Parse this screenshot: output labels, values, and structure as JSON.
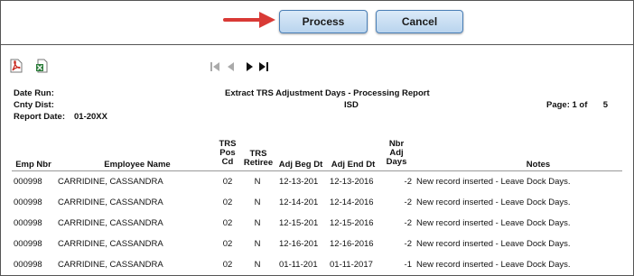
{
  "actions": {
    "process_label": "Process",
    "cancel_label": "Cancel"
  },
  "report": {
    "labels": {
      "date_run": "Date Run:",
      "cnty_dist": "Cnty Dist:",
      "report_date": "Report Date:"
    },
    "report_date_value": "01-20XX",
    "title": "Extract TRS Adjustment Days - Processing Report",
    "district": "ISD",
    "page_text": "Page: 1   of",
    "page_total": "5"
  },
  "table": {
    "headers": {
      "emp_nbr": "Emp Nbr",
      "employee_name": "Employee Name",
      "trs_pos_cd": [
        "TRS",
        "Pos",
        "Cd"
      ],
      "trs_retiree": [
        "TRS",
        "Retiree"
      ],
      "adj_beg_dt": "Adj Beg Dt",
      "adj_end_dt": "Adj End Dt",
      "nbr_adj_days": [
        "Nbr",
        "Adj",
        "Days"
      ],
      "notes": "Notes"
    },
    "rows": [
      {
        "emp": "000998",
        "name": "CARRIDINE, CASSANDRA",
        "pos": "02",
        "retiree": "N",
        "beg": "12-13-201",
        "end": "12-13-2016",
        "days": "-2",
        "notes": "New record inserted - Leave Dock Days."
      },
      {
        "emp": "000998",
        "name": "CARRIDINE, CASSANDRA",
        "pos": "02",
        "retiree": "N",
        "beg": "12-14-201",
        "end": "12-14-2016",
        "days": "-2",
        "notes": "New record inserted - Leave Dock Days."
      },
      {
        "emp": "000998",
        "name": "CARRIDINE, CASSANDRA",
        "pos": "02",
        "retiree": "N",
        "beg": "12-15-201",
        "end": "12-15-2016",
        "days": "-2",
        "notes": "New record inserted - Leave Dock Days."
      },
      {
        "emp": "000998",
        "name": "CARRIDINE, CASSANDRA",
        "pos": "02",
        "retiree": "N",
        "beg": "12-16-201",
        "end": "12-16-2016",
        "days": "-2",
        "notes": "New record inserted - Leave Dock Days."
      },
      {
        "emp": "000998",
        "name": "CARRIDINE, CASSANDRA",
        "pos": "02",
        "retiree": "N",
        "beg": "01-11-201",
        "end": "01-11-2017",
        "days": "-1",
        "notes": "New record inserted - Leave Dock Days."
      }
    ]
  },
  "icons": {
    "arrow": "red-arrow-icon",
    "pdf": "pdf-export-icon",
    "excel": "excel-export-icon",
    "first": "first-page-icon",
    "prev": "previous-page-icon",
    "next": "next-page-icon",
    "last": "last-page-icon"
  },
  "colors": {
    "button_border": "#4a7fb6",
    "arrow": "#d93a36",
    "pdf": "#c8281e",
    "excel": "#2c7d3a"
  }
}
